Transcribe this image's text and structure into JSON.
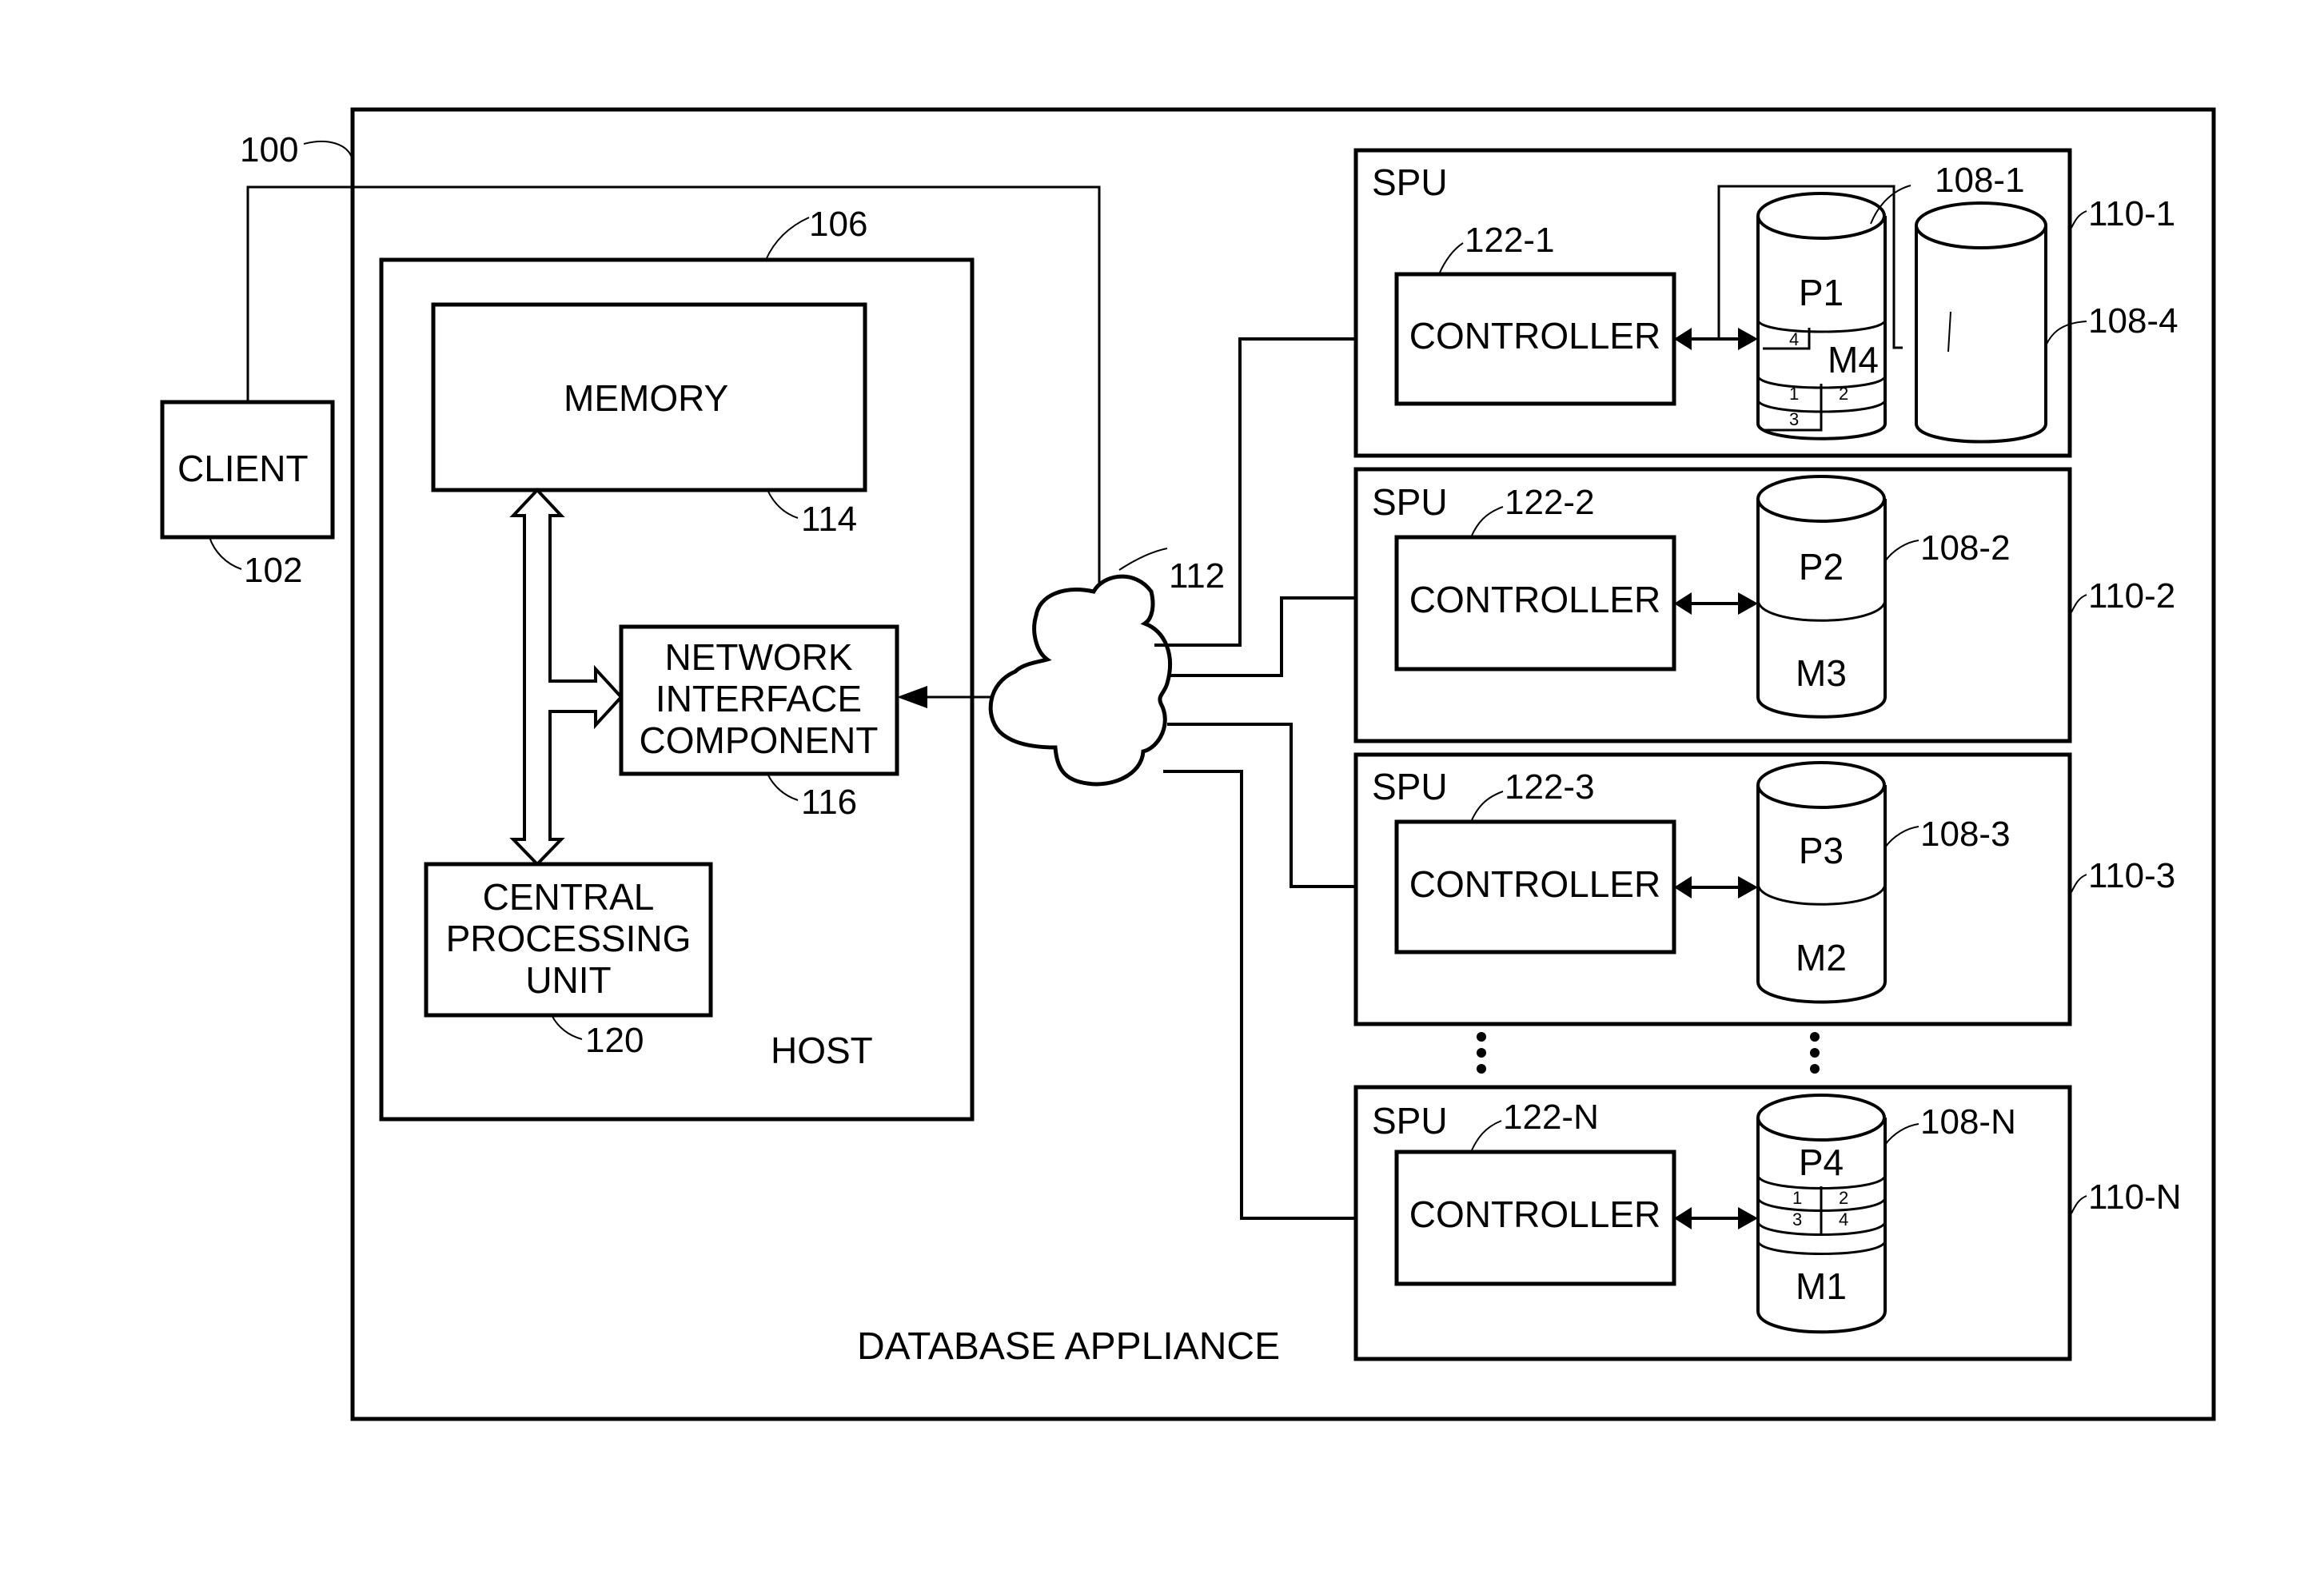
{
  "diagram": {
    "title": "DATABASE APPLIANCE",
    "appliance_ref": "100",
    "client": {
      "label": "CLIENT",
      "ref": "102"
    },
    "host": {
      "label": "HOST",
      "ref": "106",
      "memory": {
        "label": "MEMORY",
        "ref": "114"
      },
      "nic": {
        "line1": "NETWORK",
        "line2": "INTERFACE",
        "line3": "COMPONENT",
        "ref": "116"
      },
      "cpu": {
        "line1": "CENTRAL",
        "line2": "PROCESSING",
        "line3": "UNIT",
        "ref": "120"
      }
    },
    "network": {
      "ref": "112"
    },
    "spus": [
      {
        "label": "SPU",
        "ref": "110-1",
        "controller": {
          "label": "CONTROLLER",
          "ref": "122-1"
        },
        "disk": {
          "ref": "108-1",
          "primary": "P1",
          "mirror": "M4",
          "segments": [
            "4",
            "1",
            "2",
            "3"
          ]
        },
        "extra_disk": {
          "ref": "108-4"
        }
      },
      {
        "label": "SPU",
        "ref": "110-2",
        "controller": {
          "label": "CONTROLLER",
          "ref": "122-2"
        },
        "disk": {
          "ref": "108-2",
          "primary": "P2",
          "mirror": "M3"
        }
      },
      {
        "label": "SPU",
        "ref": "110-3",
        "controller": {
          "label": "CONTROLLER",
          "ref": "122-3"
        },
        "disk": {
          "ref": "108-3",
          "primary": "P3",
          "mirror": "M2"
        }
      },
      {
        "label": "SPU",
        "ref": "110-N",
        "controller": {
          "label": "CONTROLLER",
          "ref": "122-N"
        },
        "disk": {
          "ref": "108-N",
          "primary": "P4",
          "mirror": "M1",
          "segments": [
            "1",
            "2",
            "3",
            "4"
          ]
        }
      }
    ]
  }
}
